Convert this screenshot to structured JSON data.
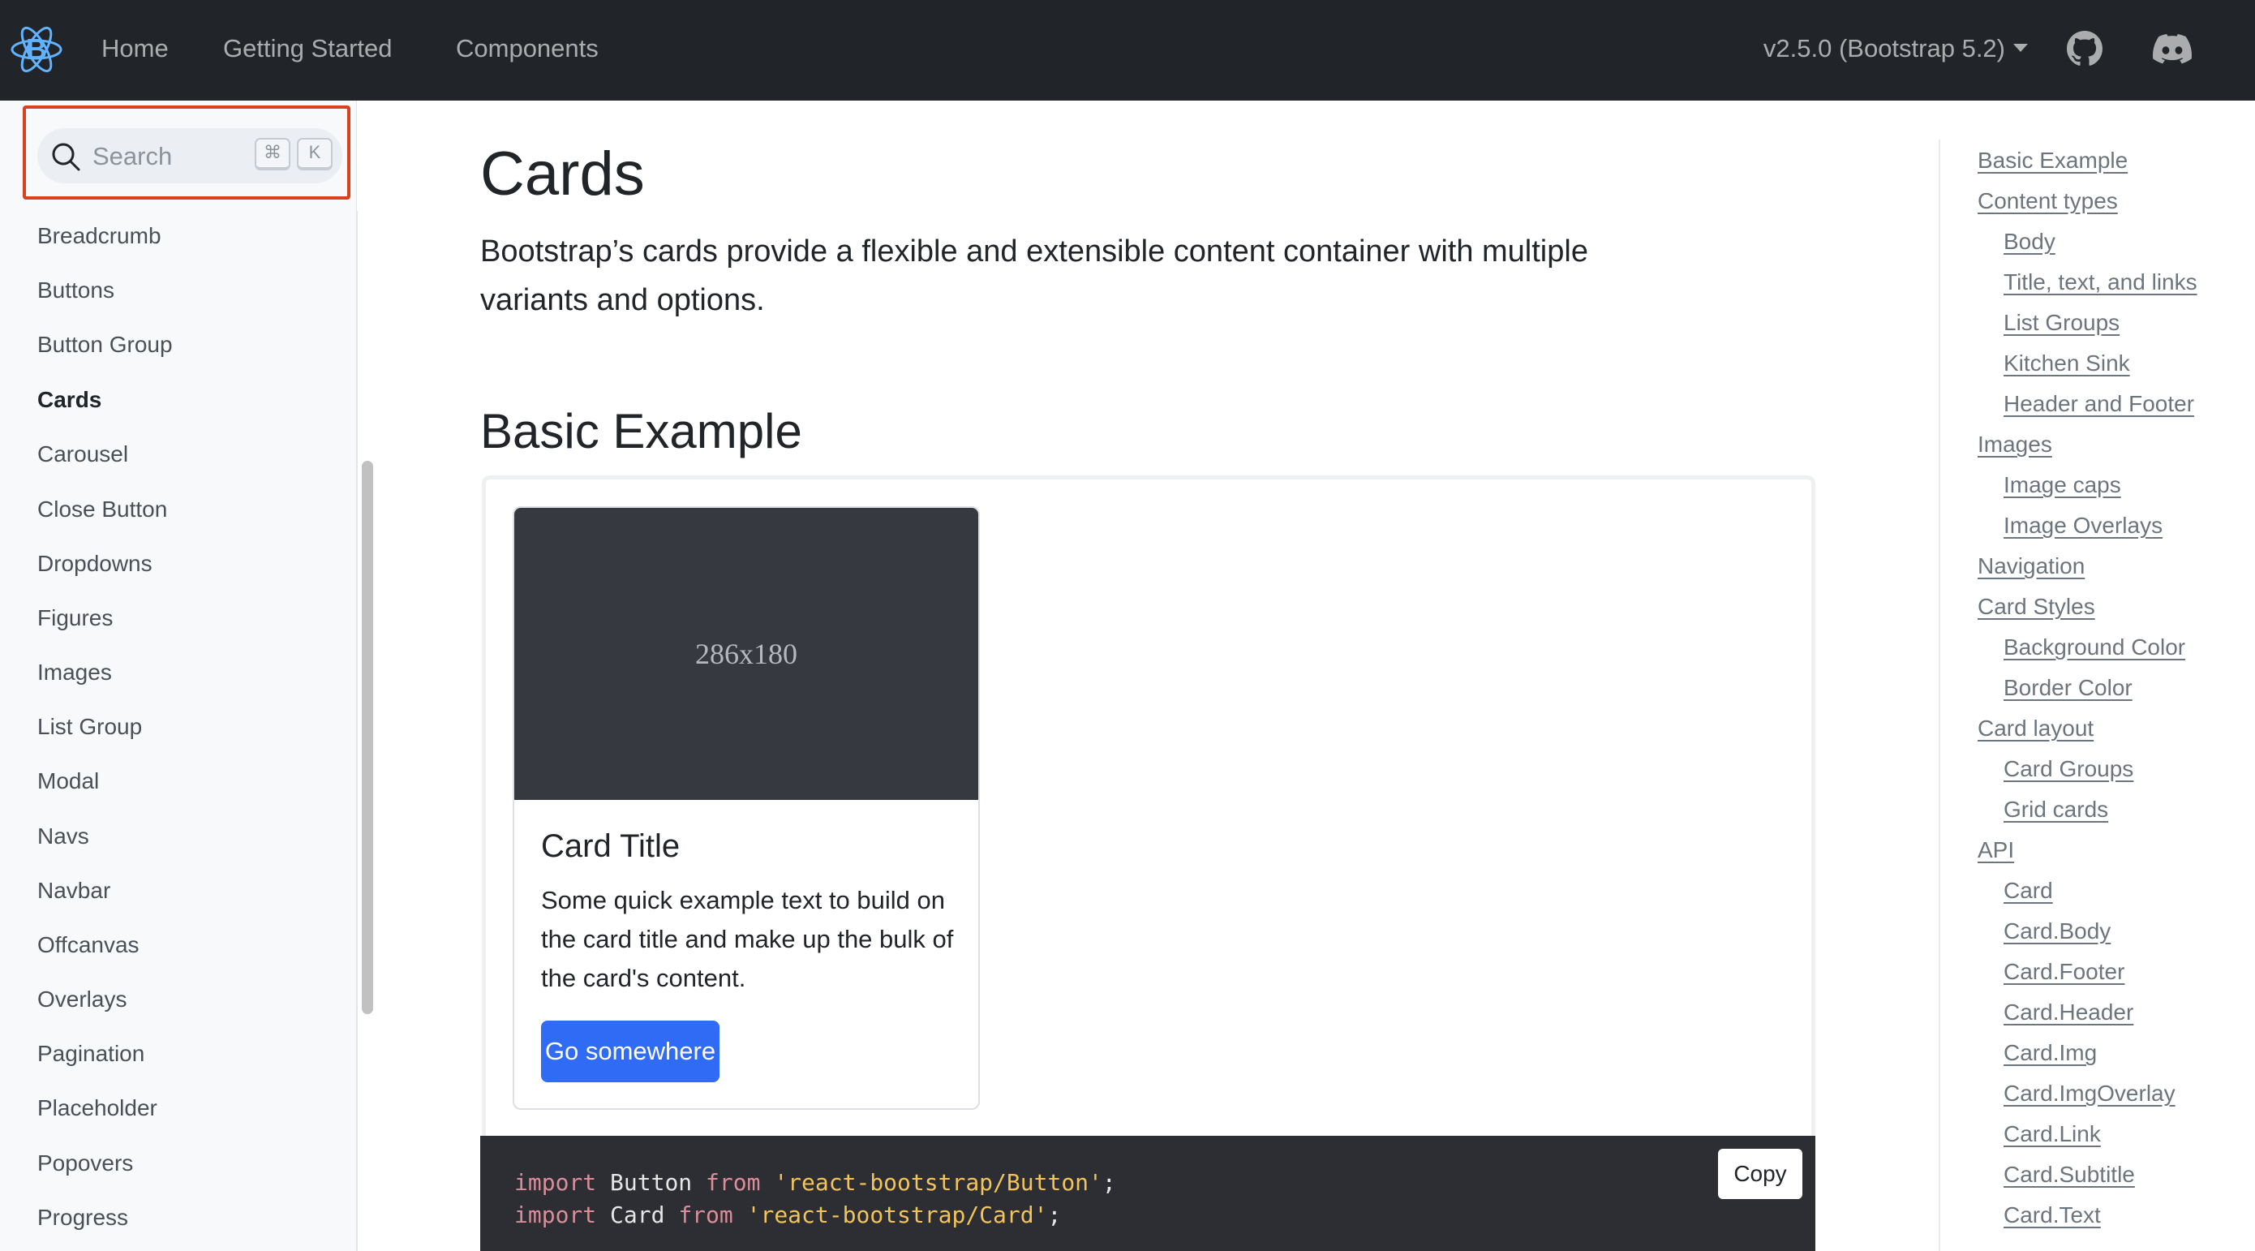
{
  "navbar": {
    "brand_icon": "react-bootstrap-logo-icon",
    "links": [
      "Home",
      "Getting Started",
      "Components"
    ],
    "version": "v2.5.0 (Bootstrap 5.2)",
    "github_icon": "github-icon",
    "discord_icon": "discord-icon",
    "background": "#212529"
  },
  "sidebar": {
    "search": {
      "placeholder": "Search",
      "kbd1": "⌘",
      "kbd2": "K",
      "highlight_color": "#d8401f"
    },
    "items": [
      "Breadcrumb",
      "Buttons",
      "Button Group",
      "Cards",
      "Carousel",
      "Close Button",
      "Dropdowns",
      "Figures",
      "Images",
      "List Group",
      "Modal",
      "Navs",
      "Navbar",
      "Offcanvas",
      "Overlays",
      "Pagination",
      "Placeholder",
      "Popovers",
      "Progress"
    ],
    "active": "Cards"
  },
  "main": {
    "title": "Cards",
    "lead": "Bootstrap’s cards provide a flexible and extensible content container with multiple variants and options.",
    "section_title": "Basic Example",
    "card": {
      "image_label": "286x180",
      "title": "Card Title",
      "text": "Some quick example text to build on the card title and make up the bulk of the card's content.",
      "button": "Go somewhere",
      "button_color": "#2f6bf5"
    },
    "code": {
      "line1": {
        "kw1": "import",
        "ident": " Button ",
        "kw2": "from",
        "str": "'react-bootstrap/Button'",
        "end": ";"
      },
      "line2": {
        "kw1": "import",
        "ident": " Card ",
        "kw2": "from",
        "str": "'react-bootstrap/Card'",
        "end": ";"
      },
      "copy": "Copy"
    }
  },
  "toc": {
    "items": [
      {
        "label": "Basic Example",
        "level": 1
      },
      {
        "label": "Content types",
        "level": 1
      },
      {
        "label": "Body",
        "level": 2
      },
      {
        "label": "Title, text, and links",
        "level": 2
      },
      {
        "label": "List Groups",
        "level": 2
      },
      {
        "label": "Kitchen Sink",
        "level": 2
      },
      {
        "label": "Header and Footer",
        "level": 2
      },
      {
        "label": "Images",
        "level": 1
      },
      {
        "label": "Image caps",
        "level": 2
      },
      {
        "label": "Image Overlays",
        "level": 2
      },
      {
        "label": "Navigation",
        "level": 1
      },
      {
        "label": "Card Styles",
        "level": 1
      },
      {
        "label": "Background Color",
        "level": 2
      },
      {
        "label": "Border Color",
        "level": 2
      },
      {
        "label": "Card layout",
        "level": 1
      },
      {
        "label": "Card Groups",
        "level": 2
      },
      {
        "label": "Grid cards",
        "level": 2
      },
      {
        "label": "API",
        "level": 1
      },
      {
        "label": "Card",
        "level": 2
      },
      {
        "label": "Card.Body",
        "level": 2
      },
      {
        "label": "Card.Footer",
        "level": 2
      },
      {
        "label": "Card.Header",
        "level": 2
      },
      {
        "label": "Card.Img",
        "level": 2
      },
      {
        "label": "Card.ImgOverlay",
        "level": 2
      },
      {
        "label": "Card.Link",
        "level": 2
      },
      {
        "label": "Card.Subtitle",
        "level": 2
      },
      {
        "label": "Card.Text",
        "level": 2
      }
    ]
  }
}
